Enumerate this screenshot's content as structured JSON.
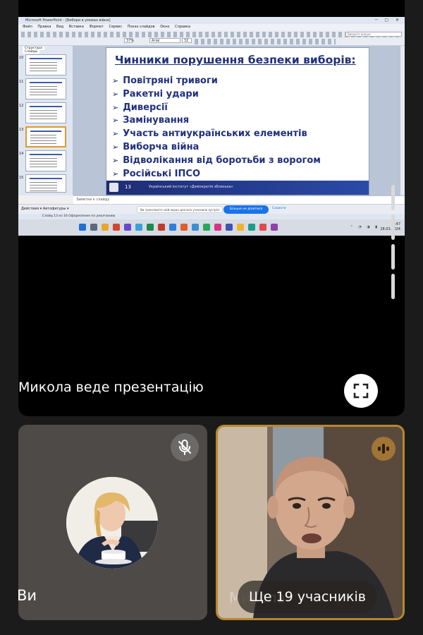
{
  "ppt": {
    "window_title": "Microsoft PowerPoint - [Вибори в умовах війни]",
    "menu": [
      "Файл",
      "Правка",
      "Вид",
      "Вставка",
      "Формат",
      "Сервис",
      "Показ слайдов",
      "Окно",
      "Справка"
    ],
    "font_name": "Arial",
    "font_size": "32",
    "zoom": "37%",
    "search_placeholder": "Введите вопрос",
    "left_tabs": [
      "Структура",
      "Слайды"
    ],
    "thumb_numbers": [
      "10",
      "11",
      "12",
      "13",
      "14",
      "15"
    ],
    "notes_placeholder": "Заметки к слайду",
    "bottom_toolbar_left": "Действия ▾   Автофигуры ▾",
    "share_notice": "Ви транслюєте свій екран для всіх учасників зустрічі",
    "share_stop_button": "Більше не ділитися",
    "share_hide": "Сховати",
    "status_text": "Слайд 13 из 16        Оформление по умолчанию",
    "clock_time": "9:47",
    "clock_date": "28.03.2024"
  },
  "slide": {
    "title": "Чинники порушення безпеки виборів:",
    "bullets": [
      "Повітряні тривоги",
      "Ракетні удари",
      "Диверсії",
      "Замінування",
      "Участь антиукраїнських елементів",
      "Виборча війна",
      "Відволікання від боротьби з ворогом",
      "Російські ІПСО"
    ],
    "footer_number": "13",
    "footer_text": "Український інститут «Демократія зблизька»"
  },
  "meet": {
    "presenter_label": "Микола веде презентацію",
    "self_name": "Ви",
    "speaker_name": "Микола",
    "more_participants": "Ще 19 учасників"
  },
  "colors": {
    "slide_text": "#21307d",
    "speaker_border": "#b9862e",
    "share_button": "#1a73e8"
  },
  "icons": {
    "fullscreen": "fullscreen-icon",
    "mic_off": "mic-off-icon",
    "speaking": "speaking-indicator-icon"
  }
}
